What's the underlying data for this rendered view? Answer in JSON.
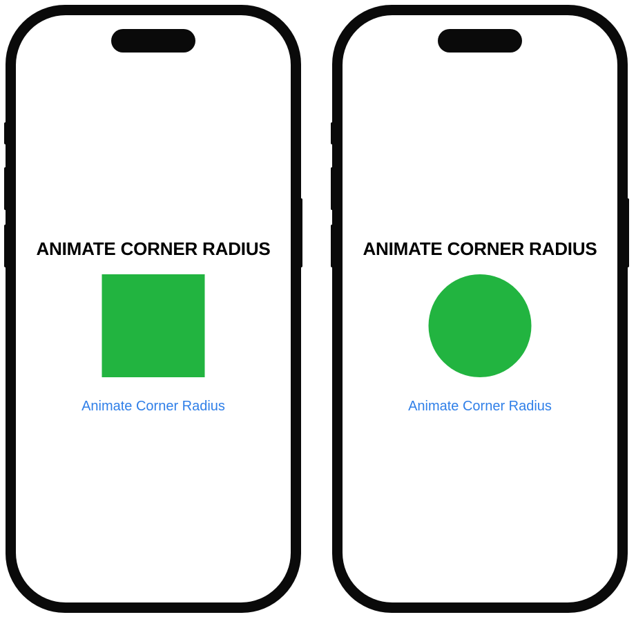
{
  "colors": {
    "frame": "#0a0a0a",
    "screen_bg": "#ffffff",
    "shape_fill": "#22b440",
    "link": "#2f7fe8",
    "title": "#000000"
  },
  "phones": [
    {
      "state": "square",
      "title": "ANIMATE CORNER RADIUS",
      "button_label": "Animate Corner Radius"
    },
    {
      "state": "circle",
      "title": "ANIMATE CORNER RADIUS",
      "button_label": "Animate Corner Radius"
    }
  ]
}
